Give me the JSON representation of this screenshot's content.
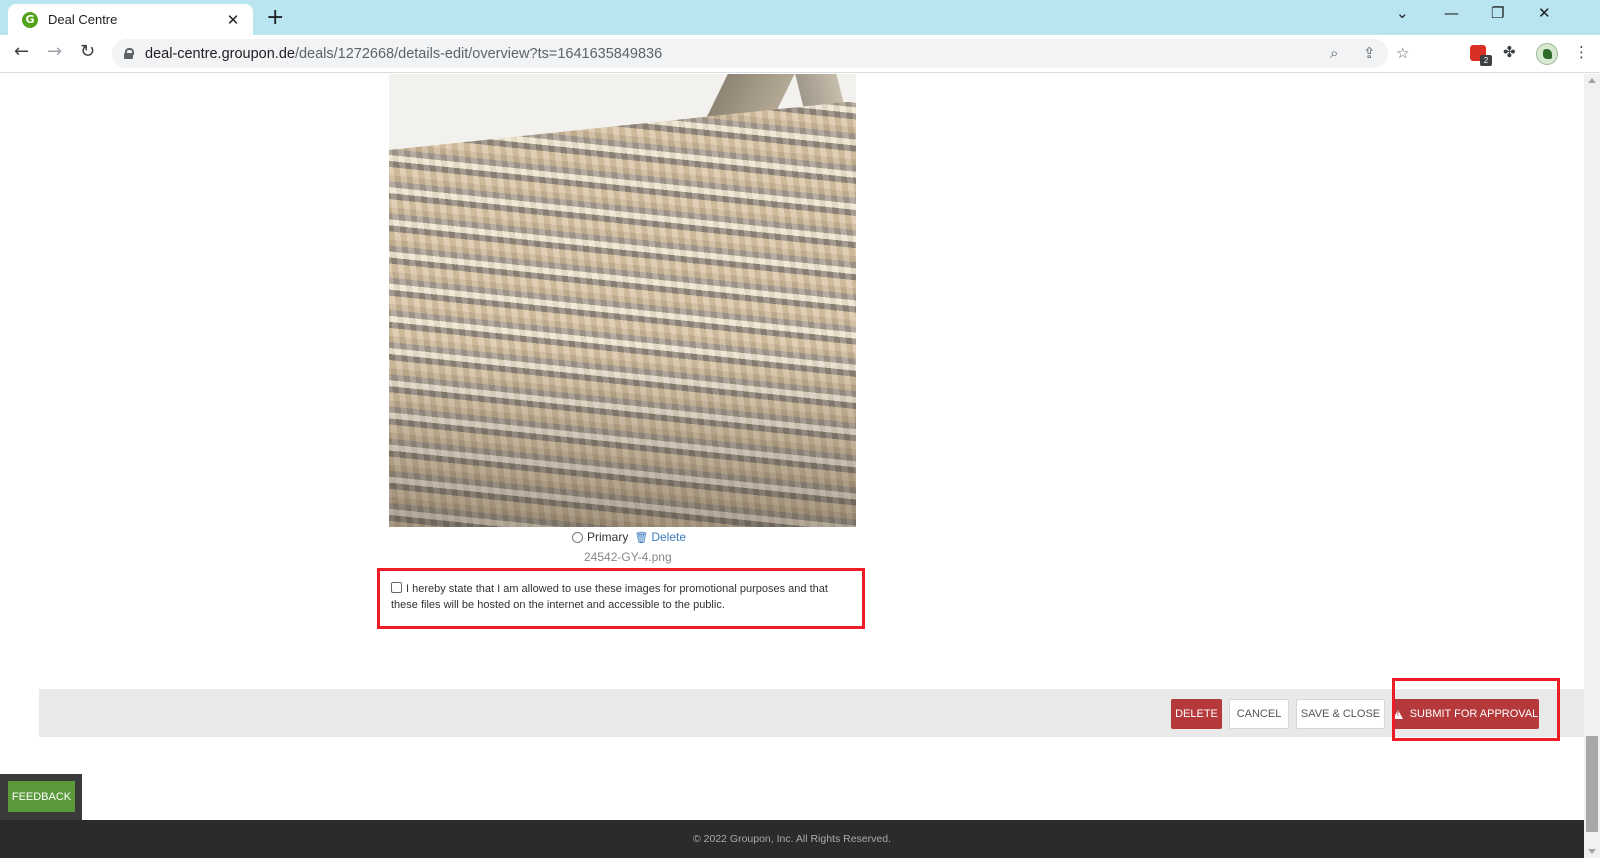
{
  "browser": {
    "tab_title": "Deal Centre",
    "favicon_letter": "G",
    "new_tab_symbol": "+",
    "tab_close_symbol": "✕",
    "url_host": "deal-centre.groupon.de",
    "url_path": "/deals/1272668/details-edit/overview?ts=1641635849836",
    "extension_badge": "2",
    "window_controls": [
      "⌄",
      "—",
      "❐",
      "✕"
    ]
  },
  "image": {
    "primary_label": "Primary",
    "delete_label": "Delete",
    "filename": "24542-GY-4.png"
  },
  "consent": {
    "text": "I hereby state that I am allowed to use these images for promotional purposes and that these files will be hosted on the internet and accessible to the public."
  },
  "actions": {
    "delete": "DELETE",
    "cancel": "CANCEL",
    "save_close": "SAVE & CLOSE",
    "submit": "SUBMIT FOR APPROVAL"
  },
  "feedback": "FEEDBACK",
  "footer": "© 2022 Groupon, Inc. All Rights Reserved.",
  "colors": {
    "brand_green": "#53a318",
    "danger_red": "#b5383b",
    "highlight_red": "#ee1c25",
    "feedback_green": "#5a9a3b",
    "tabstrip": "#b9e5f0"
  }
}
